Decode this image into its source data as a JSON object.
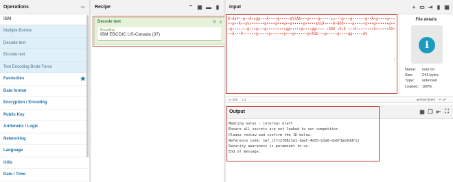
{
  "operations": {
    "title": "Operations",
    "search_value": "IBM",
    "results": [
      "Multiple Bombe",
      "Decode text",
      "Encode text",
      "Text Encoding Brute Force"
    ],
    "categories": [
      "Favourites",
      "Data format",
      "Encryption / Encoding",
      "Public Key",
      "Arithmetic / Logic",
      "Networking",
      "Language",
      "Utils",
      "Date / Time"
    ]
  },
  "recipe": {
    "title": "Recipe",
    "operation": {
      "name": "Decode text",
      "field_label": "Encoding",
      "field_value": "IBM EBCDIC US-Canada (37)"
    }
  },
  "input": {
    "title": "Input",
    "content": "Ö•Ä‡¥••@••Ä•r@@•••Ä••••@•••••£%¾ÄÉ•••@••••@•••••¢¤•••@•••@••••••@••Ä•@••••@•••••@••Ä••£%¤••••••@••••@•••@••£•••••@•••••£%¾Ä••••Ä•ÄÖÖ••••@•••••@•••@••••••@•••@•••••••@•••@•••@•••••••••@@•••••@••••@@•••• •ÖÖÖ´•Ö•Å´•••Ö••••••••Ö••••••ÖÖ•••Ä•••Ö••••••@•••••@••••••@•••@••••••@•ÄÖ£•••@•••••@••••@@•••••£%",
    "file_details": {
      "title": "File details",
      "name_label": "Name:",
      "name_value": "note.txt",
      "size_label": "Size:",
      "size_value": "241 bytes",
      "type_label": "Type:",
      "type_value": "unknown",
      "loaded_label": "Loaded:",
      "loaded_value": "100%"
    },
    "status": {
      "chars": "241",
      "lines": "1",
      "raw_bytes": "Raw Bytes",
      "eol": "LF"
    }
  },
  "output": {
    "title": "Output",
    "lines": [
      "Meeting notes - internal draft",
      "Ensure all secrets are not leaked to our competitor.",
      "Please review and confirm the ID below.",
      "Reference code: swf_ctf{276Bc1d1-1aef-4d55-b1a0-eb6f3ab9ddf1}",
      "Security awareness is paramount to us.",
      "End of message."
    ]
  },
  "colors": {
    "accent": "#1d6fa8",
    "op_card_bg": "#e6f2da",
    "highlight": "#c0392b",
    "input_text": "#d0392b"
  }
}
